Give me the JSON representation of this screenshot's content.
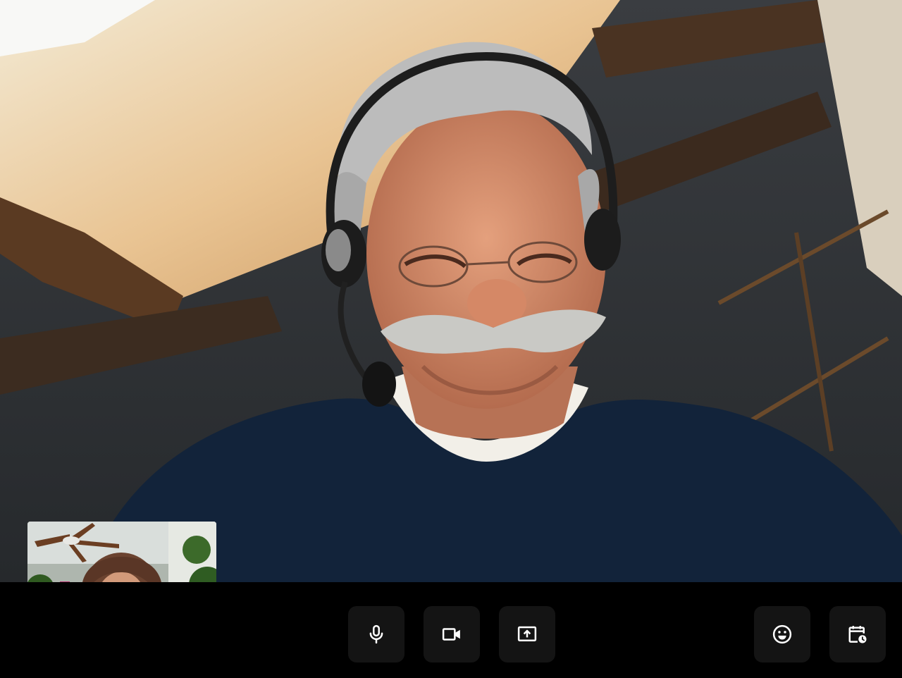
{
  "call": {
    "remote_participant": {
      "video": "camera-feed"
    },
    "self_view": {
      "video": "camera-feed"
    },
    "controls": [
      {
        "id": "microphone",
        "icon": "microphone-icon"
      },
      {
        "id": "camera",
        "icon": "video-camera-icon"
      },
      {
        "id": "share-screen",
        "icon": "share-screen-icon"
      },
      {
        "id": "reactions",
        "icon": "smiley-face-icon"
      },
      {
        "id": "schedule",
        "icon": "calendar-clock-icon"
      }
    ]
  },
  "colors": {
    "bar_background": "#000000",
    "button_background": "#141414",
    "icon_color": "#ffffff"
  }
}
